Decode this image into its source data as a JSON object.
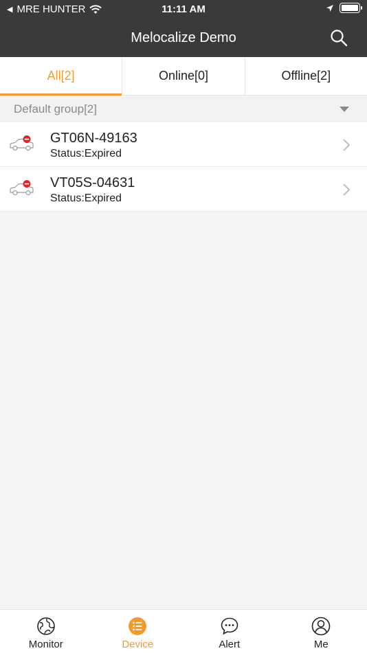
{
  "status_bar": {
    "carrier": "MRE HUNTER",
    "time": "11:11 AM",
    "battery_level": 1.0
  },
  "header": {
    "title": "Melocalize Demo"
  },
  "tabs": [
    {
      "label": "All[2]",
      "active": true
    },
    {
      "label": "Online[0]",
      "active": false
    },
    {
      "label": "Offline[2]",
      "active": false
    }
  ],
  "group": {
    "label": "Default group[2]"
  },
  "devices": [
    {
      "name": "GT06N-49163",
      "status": "Status:Expired"
    },
    {
      "name": "VT05S-04631",
      "status": "Status:Expired"
    }
  ],
  "bottom_nav": [
    {
      "label": "Monitor",
      "icon": "globe-icon",
      "active": false
    },
    {
      "label": "Device",
      "icon": "list-icon",
      "active": true
    },
    {
      "label": "Alert",
      "icon": "chat-bubble-icon",
      "active": false
    },
    {
      "label": "Me",
      "icon": "person-icon",
      "active": false
    }
  ],
  "colors": {
    "accent": "#f39a2c",
    "header_bg": "#3a3a3c",
    "expired_red": "#e0242b"
  }
}
